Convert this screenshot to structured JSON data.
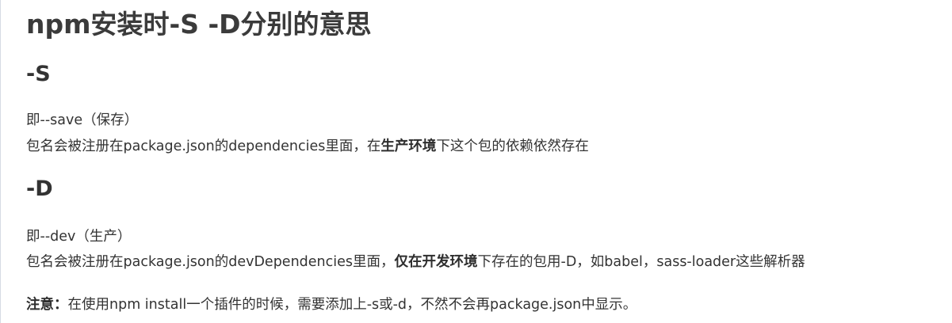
{
  "article": {
    "title": "npm安装时-S -D分别的意思",
    "section_s": {
      "heading": "-S",
      "line1": "即--save（保存）",
      "line2_before": "包名会被注册在package.json的dependencies里面，在",
      "line2_bold": "生产环境",
      "line2_after": "下这个包的依赖依然存在"
    },
    "section_d": {
      "heading": "-D",
      "line1": "即--dev（生产）",
      "line2_before": "包名会被注册在package.json的devDependencies里面，",
      "line2_bold": "仅在开发环境",
      "line2_after": "下存在的包用-D，如babel，sass-loader这些解析器"
    },
    "note": {
      "label": "注意：",
      "text": "在使用npm install一个插件的时候，需要添加上-s或-d，不然不会再package.json中显示。"
    }
  }
}
